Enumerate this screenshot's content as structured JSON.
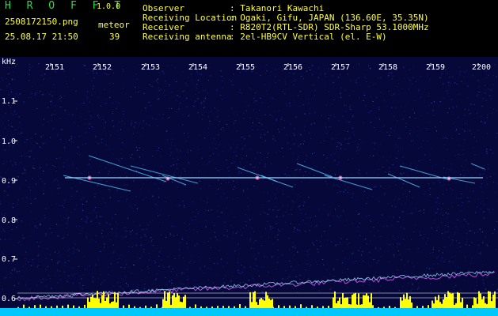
{
  "header": {
    "app_title": "H R O F F T",
    "app_version": "1.0.0",
    "file_name": "2508172150.png",
    "date_time": "25.08.17 21:50",
    "mode_label": "meteor",
    "mode_count": "39",
    "info": [
      {
        "key": "Observer",
        "value": ": Takanori Kawachi"
      },
      {
        "key": "Receiving Location",
        "value": ": Ogaki, Gifu, JAPAN (136.60E, 35.35N)"
      },
      {
        "key": "Receiver",
        "value": ": R820T2(RTL-SDR) SDR-Sharp 53.1000MHz"
      },
      {
        "key": "Receiving antenna",
        "value": ": 2el-HB9CV Vertical (el. E-W)"
      }
    ]
  },
  "spectrogram": {
    "freq_unit": "kHz",
    "freq_ticks": [
      "1.1",
      "1.0",
      "0.9",
      "0.8",
      "0.7",
      "0.6"
    ],
    "time_ticks": [
      "2151",
      "2152",
      "2153",
      "2154",
      "2155",
      "2156",
      "2157",
      "2158",
      "2159",
      "2200"
    ],
    "colors": {
      "background": "#06083a",
      "noise": "#2a3aa8",
      "echo": "#e8e8ff",
      "carrier": "#9fd8ff",
      "bar": "#ffff00",
      "floor": "#00c8ff"
    }
  }
}
